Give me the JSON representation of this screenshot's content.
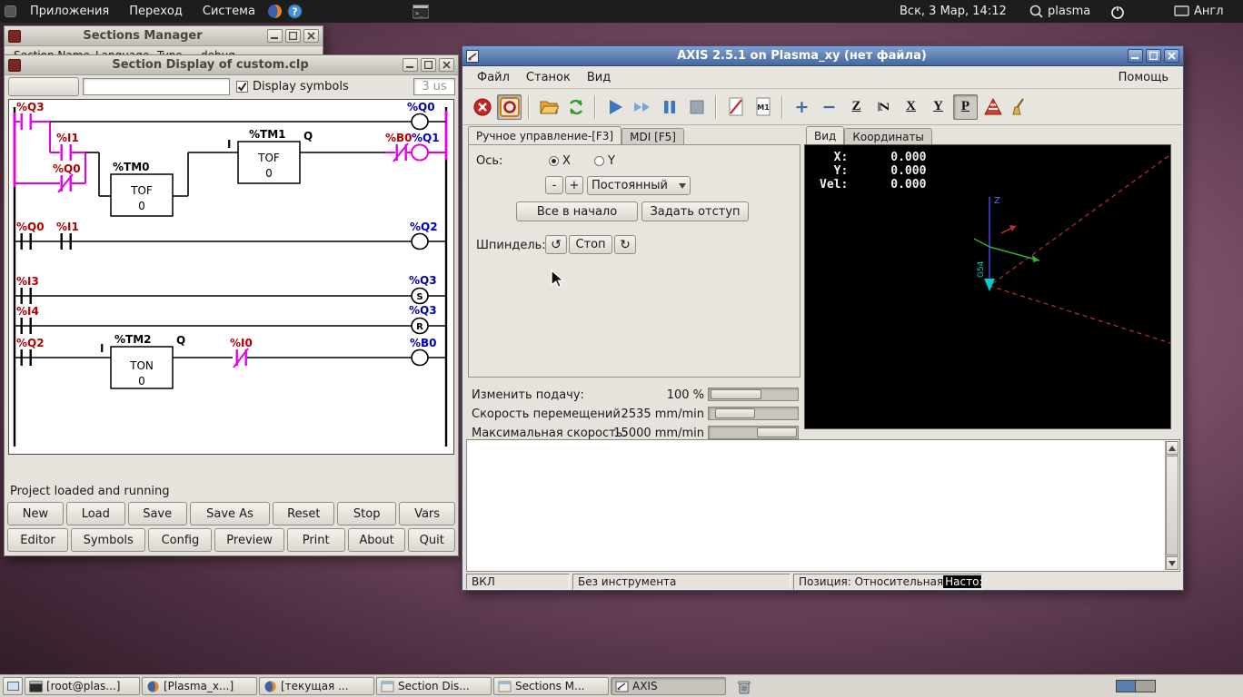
{
  "top_panel": {
    "menus": [
      "Приложения",
      "Переход",
      "Система"
    ],
    "clock": "Вск,  3 Мар, 14:12",
    "username": "plasma",
    "keyboard_layout": "Англ"
  },
  "taskbar": {
    "buttons": [
      {
        "label": "[root@plas...]"
      },
      {
        "label": "[Plasma_x...]"
      },
      {
        "label": "[текущая ..."
      },
      {
        "label": "Section Dis..."
      },
      {
        "label": "Sections M..."
      },
      {
        "label": "AXIS"
      }
    ]
  },
  "sections_manager": {
    "title": "Sections Manager",
    "columns": [
      "Section Name",
      "Language",
      "Type",
      "debug"
    ]
  },
  "section_display": {
    "title": "Section Display of custom.clp",
    "display_symbols": "Display symbols",
    "scan_time": "3 us",
    "status": "Project loaded and running",
    "buttons_row1": [
      "New",
      "Load",
      "Save",
      "Save As",
      "Reset",
      "Stop",
      "Vars"
    ],
    "buttons_row2": [
      "Editor",
      "Symbols",
      "Config",
      "Preview",
      "Print",
      "About",
      "Quit"
    ],
    "ladder": {
      "r1_q3": "%Q3",
      "r1_i1": "%I1",
      "r1_q0": "%Q0",
      "r1_tm0_name": "%TM0",
      "r1_tm0_type": "TOF",
      "r1_tm0_val": "0",
      "r1_tm1_name": "%TM1",
      "r1_tm1_type": "TOF",
      "r1_tm1_val": "0",
      "r1_in": "I",
      "r1_out": "Q",
      "r1_b0": "%B0",
      "r1_q1_coil": "%Q1",
      "r1_q0_coil": "%Q0",
      "r2_q0": "%Q0",
      "r2_i1": "%I1",
      "r2_q2": "%Q2",
      "r3_i3": "%I3",
      "r3_q3s": "%Q3",
      "r3_s": "S",
      "r3_i4": "%I4",
      "r3_q3r": "%Q3",
      "r3_r": "R",
      "r4_q2": "%Q2",
      "r4_in": "I",
      "r4_tm2_name": "%TM2",
      "r4_tm2_type": "TON",
      "r4_tm2_val": "0",
      "r4_out": "Q",
      "r4_i0": "%I0",
      "r4_b0": "%B0"
    }
  },
  "axis": {
    "title": "AXIS 2.5.1 on Plasma_xy (нет файла)",
    "menu_items": [
      "Файл",
      "Станок",
      "Вид"
    ],
    "menu_help": "Помощь",
    "tab_manual": "Ручное управление-[F3]",
    "tab_mdi": "MDI [F5]",
    "tab_preview": "Вид",
    "tab_dro": "Координаты",
    "axis_label": "Ось:",
    "axis_x": "X",
    "axis_y": "Y",
    "jog_minus": "-",
    "jog_plus": "+",
    "jog_mode": "Постоянный",
    "home_all": "Все в начало",
    "touch_off": "Задать отступ",
    "spindle_label": "Шпиндель:",
    "spindle_ccw": "↺",
    "spindle_stop": "Стоп",
    "spindle_cw": "↻",
    "sliders": [
      {
        "label": "Изменить подачу:",
        "value": "100 %"
      },
      {
        "label": "Скорость перемещений",
        "value": "2535 mm/min"
      },
      {
        "label": "Максимальная скорость:",
        "value": "15000 mm/min"
      }
    ],
    "dro_lines": "  X:      0.000\n  Y:      0.000\nVel:      0.000",
    "z_label": "Z",
    "g54": "G54",
    "toolbar": {
      "m1": "M1",
      "plus": "+",
      "minus": "−",
      "z": "Z",
      "zrot": "Z",
      "x": "X",
      "y": "Y",
      "p": "P"
    },
    "status_power": "ВКЛ",
    "status_tool": "Без инструмента",
    "status_position": "Позиция: Относительная ",
    "status_position_inverted": "Насто:"
  }
}
